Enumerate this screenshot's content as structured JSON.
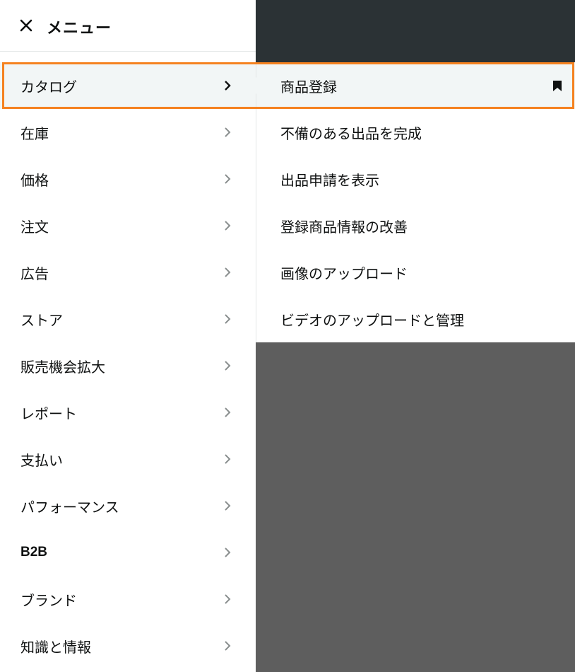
{
  "header": {
    "title": "メニュー",
    "close_icon": "close-icon"
  },
  "menu": {
    "items": [
      {
        "label": "カタログ",
        "active": true
      },
      {
        "label": "在庫"
      },
      {
        "label": "価格"
      },
      {
        "label": "注文"
      },
      {
        "label": "広告"
      },
      {
        "label": "ストア"
      },
      {
        "label": "販売機会拡大"
      },
      {
        "label": "レポート"
      },
      {
        "label": "支払い"
      },
      {
        "label": "パフォーマンス"
      },
      {
        "label": "B2B"
      },
      {
        "label": "ブランド"
      },
      {
        "label": "知識と情報"
      }
    ]
  },
  "submenu": {
    "items": [
      {
        "label": "商品登録",
        "active": true,
        "bookmarked": true
      },
      {
        "label": "不備のある出品を完成"
      },
      {
        "label": "出品申請を表示"
      },
      {
        "label": "登録商品情報の改善"
      },
      {
        "label": "画像のアップロード"
      },
      {
        "label": "ビデオのアップロードと管理"
      }
    ]
  },
  "colors": {
    "highlight": "#f58220",
    "text": "#0f1111",
    "active_bg": "#f2f6f6",
    "overlay": "#5e5e5e",
    "top_band": "#2b3235"
  }
}
